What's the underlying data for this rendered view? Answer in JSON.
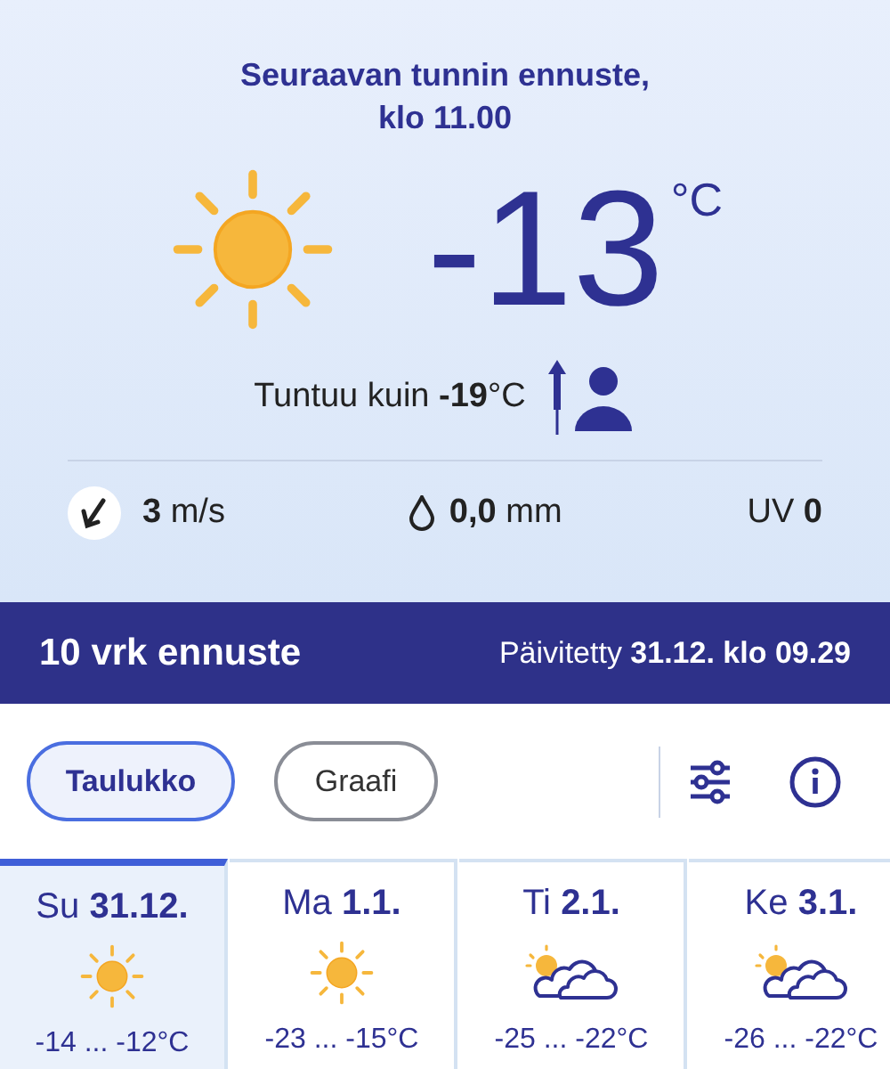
{
  "now": {
    "title": [
      "Seuraavan tunnin ennuste,",
      "klo 11.00"
    ],
    "temperature": "-13",
    "unit": "°C",
    "feels_like": "Tuntuu kuin **-19**°C",
    "wind": "**3** m/s",
    "rain": "**0,0** mm",
    "uv": "UV **0**"
  },
  "forecast_bar": {
    "title": "10 vrk ennuste",
    "updated": "Päivitetty **31.12. klo 09.29**"
  },
  "view_tabs": [
    {
      "label": "Taulukko",
      "selected": true
    },
    {
      "label": "Graafi",
      "selected": false
    }
  ],
  "days": [
    {
      "label": "Su **31.12.**",
      "kind": "sun",
      "temperature": "-14 ... -12°C",
      "selected": true
    },
    {
      "label": "Ma **1.1.**",
      "kind": "sun",
      "temperature": "-23 ... -15°C",
      "selected": false
    },
    {
      "label": "Ti **2.1.**",
      "kind": "partly_cloudy",
      "temperature": "-25 ... -22°C",
      "selected": false
    },
    {
      "label": "Ke **3.1.**",
      "kind": "partly_cloudy",
      "temperature": "-26 ... -22°C",
      "selected": false
    }
  ]
}
